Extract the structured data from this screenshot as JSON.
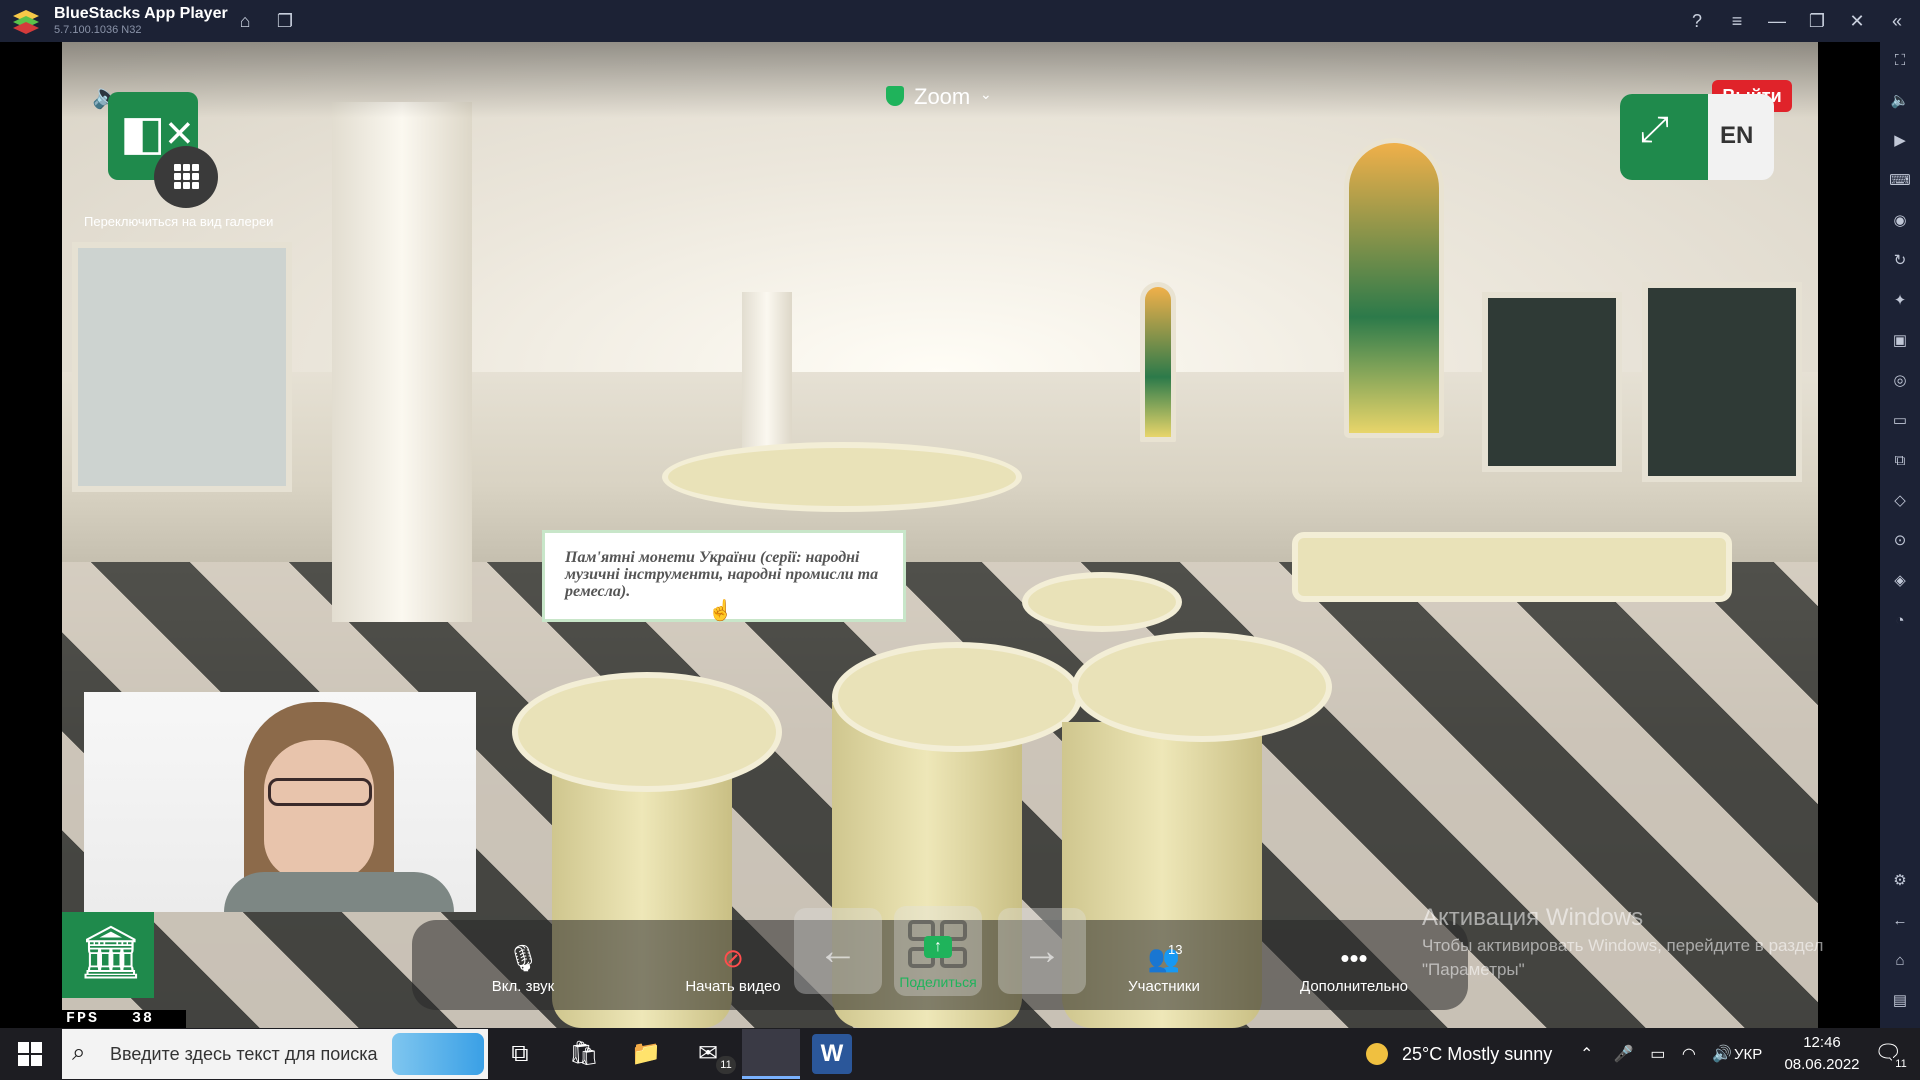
{
  "window": {
    "app_name": "BlueStacks App Player",
    "version": "5.7.100.1036  N32"
  },
  "zoom": {
    "title": "Zoom",
    "exit_label": "Выйти",
    "gallery_hint": "Переключиться на вид галереи",
    "lang_label": "EN"
  },
  "tooltip": {
    "text": "Пам'ятні монети України (серії: народні музичні інструменти, народні промисли та ремесла)."
  },
  "fps": {
    "label": "FPS",
    "value": "38"
  },
  "toolbar": {
    "audio_label": "Вкл. звук",
    "video_label": "Начать видео",
    "share_label": "Поделиться",
    "participants_label": "Участники",
    "participants_count": "13",
    "more_label": "Дополнительно"
  },
  "watermark": {
    "title": "Активация Windows",
    "line1": "Чтобы активировать Windows, перейдите в раздел",
    "line2": "\"Параметры\""
  },
  "taskbar": {
    "search_placeholder": "Введите здесь текст для поиска",
    "weather": "25°C  Mostly sunny",
    "language": "УКР",
    "time": "12:46",
    "date": "08.06.2022",
    "mail_badge": "11",
    "notif_badge": "11"
  },
  "colors": {
    "zoom_green": "#1f8a4c",
    "exit_red": "#e0232a",
    "share_green": "#1fb35b",
    "titlebar": "#1c2235"
  }
}
